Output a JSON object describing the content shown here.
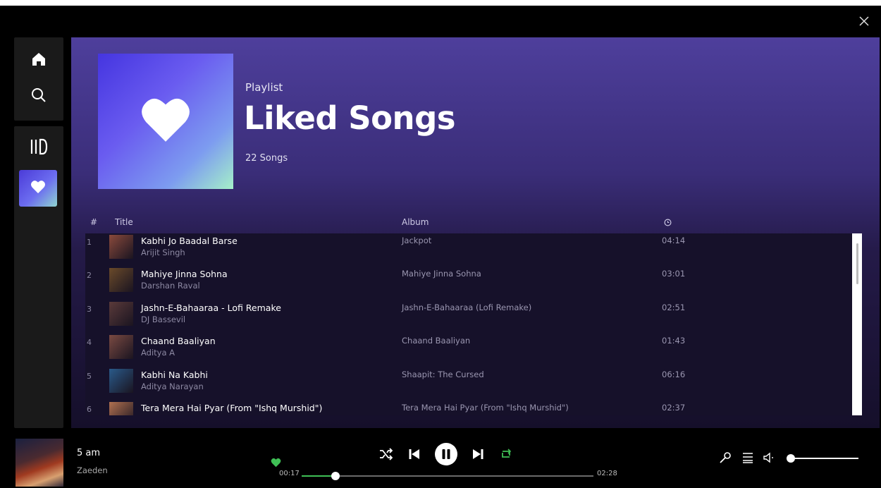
{
  "window": {
    "close_icon": "close-icon"
  },
  "sidebar": {
    "nav": [
      {
        "icon": "home-icon"
      },
      {
        "icon": "search-icon"
      }
    ],
    "library_icon": "library-icon",
    "liked_icon": "heart-icon"
  },
  "playlist": {
    "type": "Playlist",
    "title": "Liked Songs",
    "count": "22 Songs"
  },
  "table": {
    "headers": {
      "num": "#",
      "title": "Title",
      "album": "Album",
      "duration_icon": "clock-icon"
    },
    "rows": [
      {
        "num": "1",
        "title": "Kabhi Jo Baadal Barse",
        "artist": "Arijit Singh",
        "album": "Jackpot",
        "duration": "04:14",
        "thumb": "#8a4a3c"
      },
      {
        "num": "2",
        "title": "Mahiye Jinna Sohna",
        "artist": "Darshan Raval",
        "album": "Mahiye Jinna Sohna",
        "duration": "03:01",
        "thumb": "#6a4a2a"
      },
      {
        "num": "3",
        "title": "Jashn-E-Bahaaraa - Lofi Remake",
        "artist": "DJ Bassevil",
        "album": "Jashn-E-Bahaaraa (Lofi Remake)",
        "duration": "02:51",
        "thumb": "#5a3a3a"
      },
      {
        "num": "4",
        "title": "Chaand Baaliyan",
        "artist": "Aditya A",
        "album": "Chaand Baaliyan",
        "duration": "01:43",
        "thumb": "#7a4a42"
      },
      {
        "num": "5",
        "title": "Kabhi Na Kabhi",
        "artist": "Aditya Narayan",
        "album": "Shaapit: The Cursed",
        "duration": "06:16",
        "thumb": "#2a5a8a"
      },
      {
        "num": "6",
        "title": "Tera Mera Hai Pyar (From \"Ishq Murshid\")",
        "artist": "",
        "album": "Tera Mera Hai Pyar (From \"Ishq Murshid\")",
        "duration": "02:37",
        "thumb": "#b07050"
      }
    ]
  },
  "player": {
    "track_title": "5 am",
    "track_artist": "Zaeden",
    "liked": true,
    "elapsed": "00:17",
    "total": "02:28",
    "progress": 0.115,
    "volume": 0.0,
    "colors": {
      "accent": "#3fbf55"
    }
  }
}
